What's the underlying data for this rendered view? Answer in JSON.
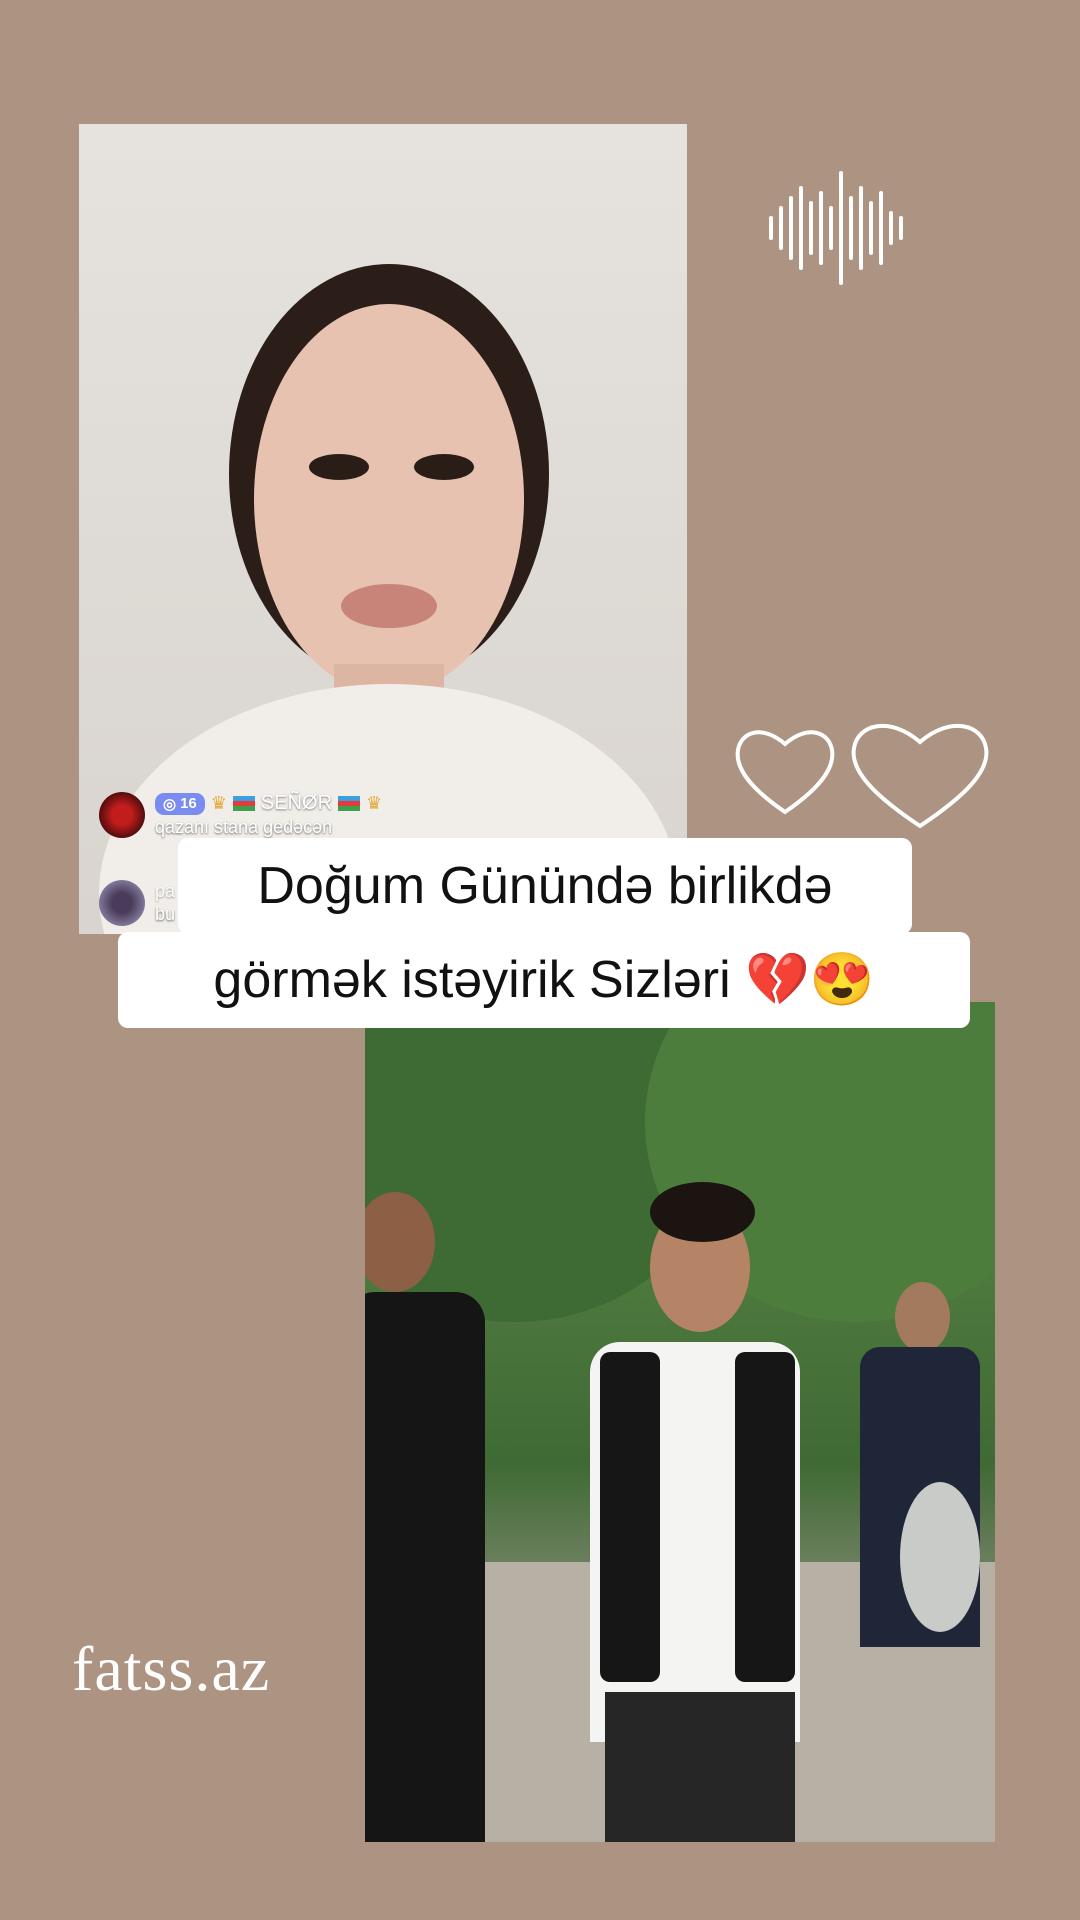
{
  "caption": {
    "line1": "Doğum Günündə birlikdə",
    "line2": "görmək istəyirik Sizləri 💔😍"
  },
  "live_overlay": {
    "comment1": {
      "badge_level": "16",
      "username": "SEÑØR",
      "text": "qazanı stana gedəcən"
    },
    "comment2": {
      "username": "pa",
      "text": "bu"
    }
  },
  "decorations": {
    "sound_wave_icon": "sound-wave-icon",
    "hearts_icon": "hearts-outline-icon"
  },
  "watermark": "fatss.az",
  "colors": {
    "background": "#ad9382",
    "caption_bg": "#ffffff",
    "caption_text": "#111111",
    "badge": "#7a8cf0"
  }
}
